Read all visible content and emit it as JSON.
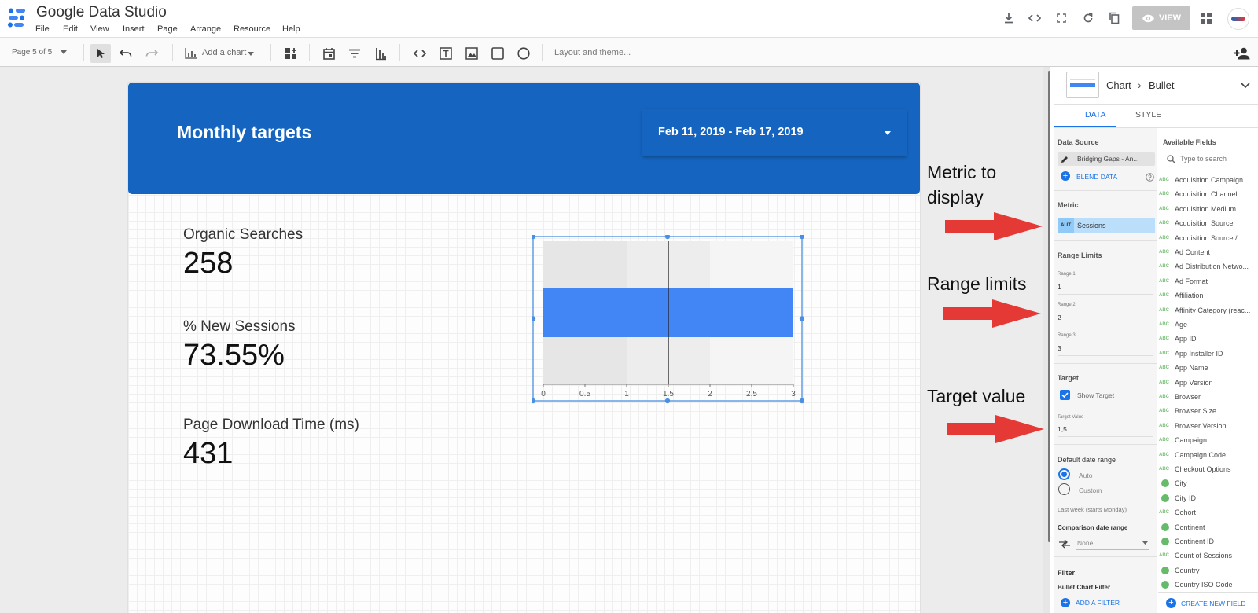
{
  "app": {
    "title": "Google Data Studio",
    "accent": "#1565c0"
  },
  "menu": [
    "File",
    "Edit",
    "View",
    "Insert",
    "Page",
    "Arrange",
    "Resource",
    "Help"
  ],
  "top_actions": {
    "view_label": "VIEW",
    "icons": [
      "download-icon",
      "embed-code-icon",
      "fullscreen-icon",
      "refresh-icon",
      "copy-icon",
      "apps-grid-icon",
      "account-logo"
    ]
  },
  "toolbar": {
    "page_label": "Page 5 of 5",
    "add_chart_label": "Add a chart",
    "layout_theme_label": "Layout and theme...",
    "icons": [
      "select-pointer-icon",
      "undo-icon",
      "redo-icon",
      "add-chart-icon",
      "community-viz-icon",
      "date-range-icon",
      "filter-control-icon",
      "data-control-icon",
      "url-embed-icon",
      "text-box-icon",
      "image-icon",
      "rectangle-icon",
      "circle-icon",
      "add-person-icon"
    ]
  },
  "report": {
    "header_title": "Monthly targets",
    "header_color": "#1565c0",
    "date_range": "Feb 11, 2019 - Feb 17, 2019",
    "scorecards": [
      {
        "label": "Organic Searches",
        "value": "258"
      },
      {
        "label": "% New Sessions",
        "value": "73.55%"
      },
      {
        "label": "Page Download Time (ms)",
        "value": "431"
      }
    ]
  },
  "chart_data": {
    "type": "bar",
    "subtype": "bullet",
    "orientation": "horizontal",
    "x_ticks": [
      "0",
      "0.5",
      "1",
      "1.5",
      "2",
      "2.5",
      "3"
    ],
    "xlim": [
      0,
      3
    ],
    "ranges": [
      1,
      2,
      3
    ],
    "range_colors": [
      "#e6e6e6",
      "#ededed",
      "#f5f5f5"
    ],
    "value": 3,
    "target": 1.5,
    "bar_color": "#4285f4"
  },
  "panel": {
    "chart_type": "Chart",
    "chart_subtype": "Bullet",
    "tabs": [
      "DATA",
      "STYLE"
    ],
    "data_source_label": "Data Source",
    "data_source_value": "Bridging Gaps - An...",
    "blend_data_label": "BLEND DATA",
    "metric_label": "Metric",
    "metric_badge": "AUT",
    "metric_value": "Sessions",
    "range_limits_label": "Range Limits",
    "range1_label": "Range 1",
    "range1_value": "1",
    "range2_label": "Range 2",
    "range2_value": "2",
    "range3_label": "Range 3",
    "range3_value": "3",
    "target_label": "Target",
    "show_target_label": "Show Target",
    "target_value_label": "Target Value",
    "target_value": "1,5",
    "default_date_range_label": "Default date range",
    "auto_label": "Auto",
    "custom_label": "Custom",
    "last_week_label": "Last week (starts Monday)",
    "comparison_label": "Comparison date range",
    "comparison_value": "None",
    "filter_label": "Filter",
    "bullet_filter_label": "Bullet Chart Filter",
    "add_filter_label": "ADD A FILTER",
    "available_fields_label": "Available Fields",
    "search_placeholder": "Type to search",
    "create_field_label": "CREATE NEW FIELD",
    "fields": [
      {
        "name": "Acquisition Campaign",
        "kind": "text"
      },
      {
        "name": "Acquisition Channel",
        "kind": "text"
      },
      {
        "name": "Acquisition Medium",
        "kind": "text"
      },
      {
        "name": "Acquisition Source",
        "kind": "text"
      },
      {
        "name": "Acquisition Source / ...",
        "kind": "text"
      },
      {
        "name": "Ad Content",
        "kind": "text"
      },
      {
        "name": "Ad Distribution Netwo...",
        "kind": "text"
      },
      {
        "name": "Ad Format",
        "kind": "text"
      },
      {
        "name": "Affiliation",
        "kind": "text"
      },
      {
        "name": "Affinity Category (reac...",
        "kind": "text"
      },
      {
        "name": "Age",
        "kind": "text"
      },
      {
        "name": "App ID",
        "kind": "text"
      },
      {
        "name": "App Installer ID",
        "kind": "text"
      },
      {
        "name": "App Name",
        "kind": "text"
      },
      {
        "name": "App Version",
        "kind": "text"
      },
      {
        "name": "Browser",
        "kind": "text"
      },
      {
        "name": "Browser Size",
        "kind": "text"
      },
      {
        "name": "Browser Version",
        "kind": "text"
      },
      {
        "name": "Campaign",
        "kind": "text"
      },
      {
        "name": "Campaign Code",
        "kind": "text"
      },
      {
        "name": "Checkout Options",
        "kind": "text"
      },
      {
        "name": "City",
        "kind": "geo"
      },
      {
        "name": "City ID",
        "kind": "geo"
      },
      {
        "name": "Cohort",
        "kind": "text"
      },
      {
        "name": "Continent",
        "kind": "geo"
      },
      {
        "name": "Continent ID",
        "kind": "geo"
      },
      {
        "name": "Count of Sessions",
        "kind": "text"
      },
      {
        "name": "Country",
        "kind": "geo"
      },
      {
        "name": "Country ISO Code",
        "kind": "geo"
      }
    ]
  },
  "annotations": {
    "metric": "Metric to display",
    "range": "Range limits",
    "target": "Target value",
    "arrow_color": "#e53935"
  }
}
